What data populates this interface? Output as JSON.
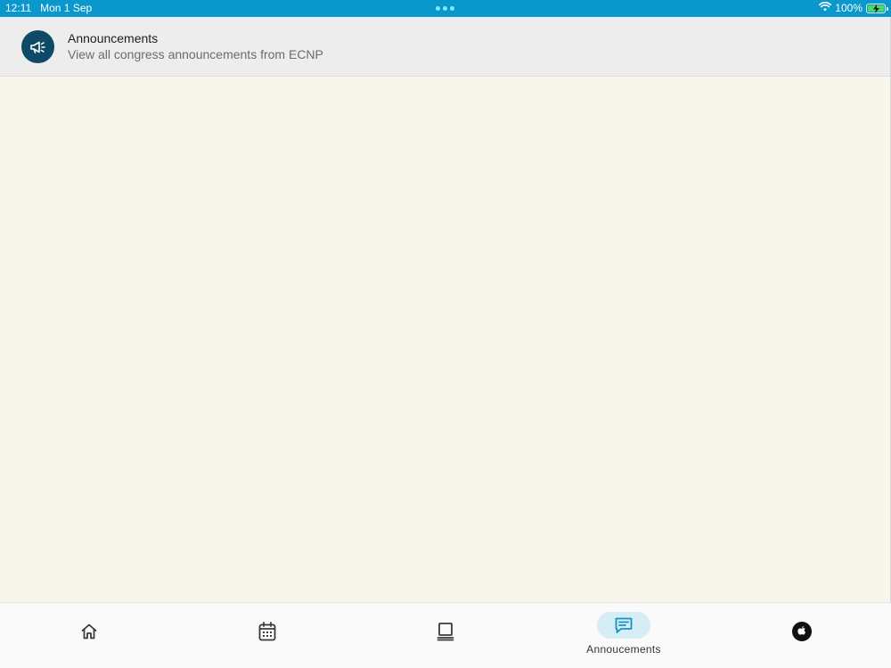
{
  "status_bar": {
    "time": "12:11",
    "date": "Mon 1 Sep",
    "battery": "100%",
    "icons": [
      "wifi-icon",
      "battery-charging-icon"
    ]
  },
  "header": {
    "icon": "megaphone-icon",
    "title": "Announcements",
    "subtitle": "View all congress announcements from ECNP"
  },
  "tabs": [
    {
      "icon": "home-icon",
      "label": ""
    },
    {
      "icon": "calendar-icon",
      "label": ""
    },
    {
      "icon": "laptop-icon",
      "label": ""
    },
    {
      "icon": "chat-icon",
      "label": "Annoucements",
      "active": true
    },
    {
      "icon": "apple-icon",
      "label": ""
    }
  ],
  "colors": {
    "status_bar": "#0a97cc",
    "avatar": "#0d4a66",
    "content_bg": "#f8f6ec",
    "active_pill": "#d7edf6",
    "active_icon": "#1592c4"
  }
}
